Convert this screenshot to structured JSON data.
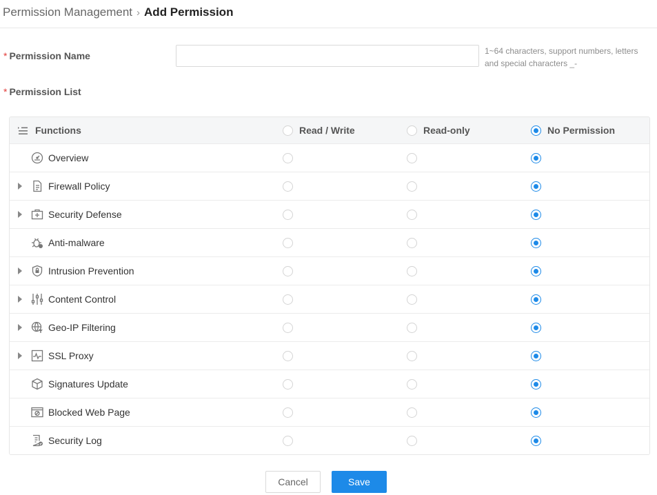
{
  "breadcrumb": {
    "parent": "Permission Management",
    "separator": "›",
    "current": "Add Permission"
  },
  "form": {
    "required_mark": "*",
    "name_label": "Permission Name",
    "name_value": "",
    "name_placeholder": "",
    "name_hint": "1~64 characters, support numbers, letters and special characters _-",
    "list_label": "Permission List"
  },
  "table": {
    "headers": {
      "functions": "Functions",
      "read_write": "Read / Write",
      "read_only": "Read-only",
      "no_permission": "No Permission"
    },
    "header_selected": "no_permission",
    "rows": [
      {
        "label": "Overview",
        "icon": "gauge-icon",
        "expandable": false,
        "selected": "no_permission"
      },
      {
        "label": "Firewall Policy",
        "icon": "document-icon",
        "expandable": true,
        "selected": "no_permission"
      },
      {
        "label": "Security Defense",
        "icon": "medkit-icon",
        "expandable": true,
        "selected": "no_permission"
      },
      {
        "label": "Anti-malware",
        "icon": "bug-icon",
        "expandable": false,
        "selected": "no_permission"
      },
      {
        "label": "Intrusion Prevention",
        "icon": "shield-lock-icon",
        "expandable": true,
        "selected": "no_permission"
      },
      {
        "label": "Content Control",
        "icon": "sliders-icon",
        "expandable": true,
        "selected": "no_permission"
      },
      {
        "label": "Geo-IP Filtering",
        "icon": "globe-filter-icon",
        "expandable": true,
        "selected": "no_permission"
      },
      {
        "label": "SSL Proxy",
        "icon": "pulse-icon",
        "expandable": true,
        "selected": "no_permission"
      },
      {
        "label": "Signatures Update",
        "icon": "cube-icon",
        "expandable": false,
        "selected": "no_permission"
      },
      {
        "label": "Blocked Web Page",
        "icon": "blocked-browser-icon",
        "expandable": false,
        "selected": "no_permission"
      },
      {
        "label": "Security Log",
        "icon": "log-check-icon",
        "expandable": false,
        "selected": "no_permission"
      }
    ]
  },
  "actions": {
    "cancel": "Cancel",
    "save": "Save"
  },
  "colors": {
    "accent": "#1d8ae8",
    "required": "#e23c39"
  }
}
